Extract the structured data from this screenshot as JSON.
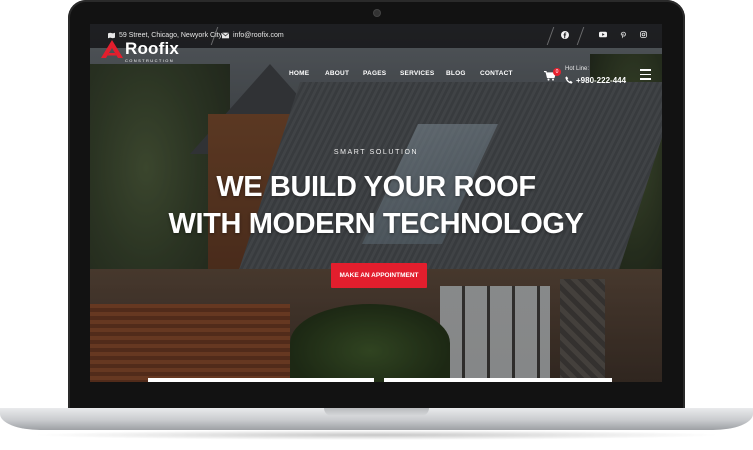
{
  "topbar": {
    "address": "59 Street, Chicago, Newyork City",
    "email": "info@roofix.com",
    "social_icons": [
      "facebook-icon",
      "youtube-icon",
      "pinterest-icon",
      "instagram-icon"
    ]
  },
  "brand": {
    "name": "Roofix",
    "tagline": "CONSTRUCTION",
    "accent_color": "#e31e2d"
  },
  "nav": {
    "items": [
      {
        "label": "HOME"
      },
      {
        "label": "ABOUT"
      },
      {
        "label": "PAGES"
      },
      {
        "label": "SERVICES"
      },
      {
        "label": "BLOG"
      },
      {
        "label": "CONTACT"
      }
    ],
    "cart_count": "0",
    "hotline_label": "Hot Line:",
    "hotline_number": "+980-222-444"
  },
  "hero": {
    "subtitle": "SMART SOLUTION",
    "title_line1": "WE BUILD YOUR ROOF",
    "title_line2": "WITH MODERN TECHNOLOGY",
    "cta_label": "MAKE AN APPOINTMENT"
  }
}
